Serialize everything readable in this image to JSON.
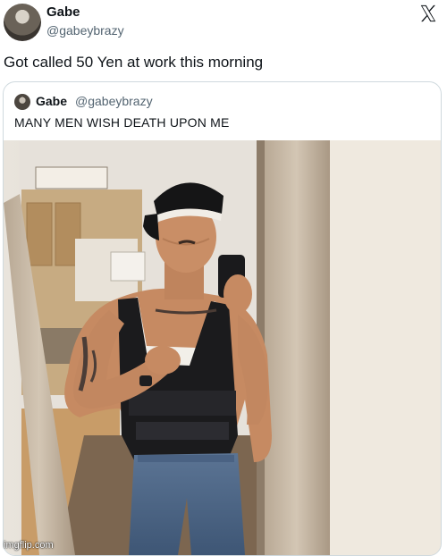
{
  "author": {
    "display_name": "Gabe",
    "handle": "@gabeybrazy"
  },
  "tweet": {
    "text": "Got called 50 Yen at work this morning"
  },
  "quoted_tweet": {
    "display_name": "Gabe",
    "handle": "@gabeybrazy",
    "text": "MANY MEN WISH DEATH UPON ME"
  },
  "icons": {
    "platform_logo": "x-logo-icon"
  },
  "watermark": "imgflip.com"
}
